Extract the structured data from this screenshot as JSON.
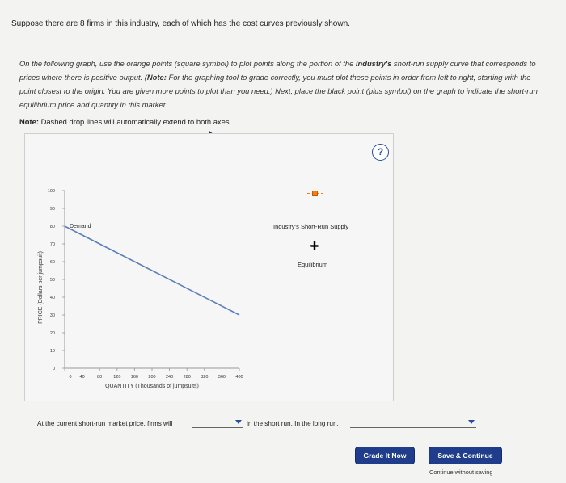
{
  "intro": "Suppose there are 8 firms in this industry, each of which has the cost curves previously shown.",
  "instructions": {
    "part1": "On the following graph, use the orange points (square symbol) to plot points along the portion of the ",
    "bold1": "industry's",
    "part2": " short-run supply curve that corresponds to prices where there is positive output. (",
    "bold2": "Note:",
    "part3": " For the graphing tool to grade correctly, you must plot these points in order from left to right, starting with the point closest to the origin. You are given more points to plot than you need.) Next, place the black point (plus symbol) on the graph to indicate the short-run equilibrium price and quantity in this market."
  },
  "note": {
    "label": "Note:",
    "text": " Dashed drop lines will automatically extend to both axes."
  },
  "help_symbol": "?",
  "legend": {
    "supply_label": "Industry's Short-Run Supply",
    "equilibrium_label": "Equilibrium",
    "supply_color": "#f07f17",
    "equilibrium_color": "#000000"
  },
  "chart_data": {
    "type": "line",
    "xlabel": "QUANTITY (Thousands of jumpsuits)",
    "ylabel": "PRICE (Dollars per jumpsuit)",
    "xlim": [
      0,
      400
    ],
    "ylim": [
      0,
      100
    ],
    "x_ticks": [
      0,
      40,
      80,
      120,
      160,
      200,
      240,
      280,
      320,
      360,
      400
    ],
    "y_ticks": [
      0,
      10,
      20,
      30,
      40,
      50,
      60,
      70,
      80,
      90,
      100
    ],
    "series": [
      {
        "name": "Demand",
        "x": [
          0,
          400
        ],
        "y": [
          80,
          30
        ],
        "color": "#5b7fb8"
      }
    ]
  },
  "bottom": {
    "text1": "At the current short-run market price, firms will",
    "text2": "in the short run. In the long run,",
    "dropdown1_value": "",
    "dropdown2_value": ""
  },
  "buttons": {
    "grade": "Grade It Now",
    "save": "Save & Continue",
    "continue_link": "Continue without saving"
  }
}
